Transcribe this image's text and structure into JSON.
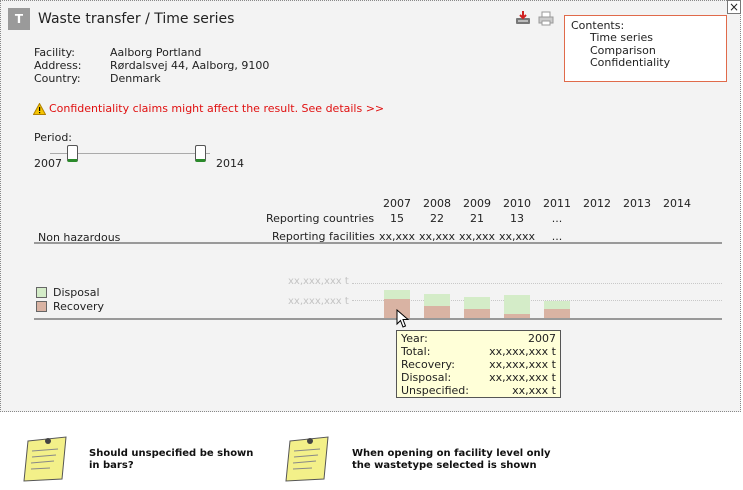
{
  "header": {
    "logo_letter": "T",
    "title": "Waste transfer / Time series",
    "close_glyph": "×"
  },
  "contents": {
    "heading": "Contents:",
    "items": [
      "Time series",
      "Comparison",
      "Confidentiality"
    ]
  },
  "facility": {
    "labels": [
      "Facility:",
      "Address:",
      "Country:"
    ],
    "values": [
      "Aalborg Portland",
      "Rørdalsvej 44, Aalborg, 9100",
      "Denmark"
    ]
  },
  "warning": {
    "text": "Confidentiality claims might affect the result. See details >>"
  },
  "period": {
    "label": "Period:",
    "start": "2007",
    "end": "2014"
  },
  "table": {
    "years": [
      "2007",
      "2008",
      "2009",
      "2010",
      "2011",
      "2012",
      "2013",
      "2014"
    ],
    "row_labels": {
      "countries": "Reporting countries",
      "facilities": "Reporting facilities"
    },
    "countries": [
      "15",
      "22",
      "21",
      "13",
      "..."
    ],
    "facilities": [
      "xx,xxx",
      "xx,xxx",
      "xx,xxx",
      "xx,xxx",
      "..."
    ],
    "category": "Non hazardous"
  },
  "chart": {
    "gridlabels": [
      "xx,xxx,xxx t",
      "xx,xxx,xxx t"
    ],
    "legend": [
      {
        "label": "Disposal",
        "color": "#d4ecc8"
      },
      {
        "label": "Recovery",
        "color": "#d9b3a3"
      }
    ]
  },
  "chart_data": {
    "type": "bar",
    "categories": [
      "2007",
      "2008",
      "2009",
      "2010",
      "2011"
    ],
    "series": [
      {
        "name": "Recovery",
        "values": [
          19,
          12,
          9,
          4,
          9
        ]
      },
      {
        "name": "Disposal",
        "values": [
          9,
          12,
          12,
          19,
          8
        ]
      }
    ]
  },
  "tooltip": {
    "rows": [
      {
        "label": "Year:",
        "value": "2007"
      },
      {
        "label": "Total:",
        "value": "xx,xxx,xxx t"
      },
      {
        "label": "Recovery:",
        "value": "xx,xxx,xxx t"
      },
      {
        "label": "Disposal:",
        "value": "xx,xxx,xxx t"
      },
      {
        "label": "Unspecified:",
        "value": "xx,xxx t"
      }
    ]
  },
  "notes": [
    "Should unspecified be shown in bars?",
    "When opening on facility level only the wastetype selected is shown"
  ]
}
